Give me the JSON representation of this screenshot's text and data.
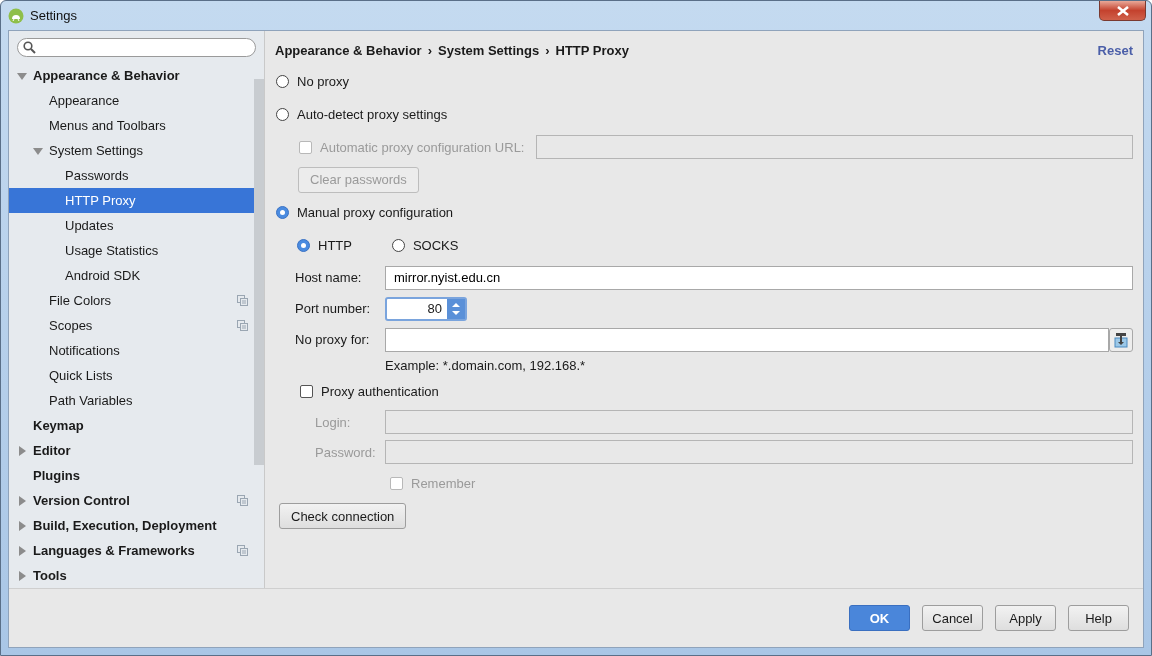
{
  "window": {
    "title": "Settings"
  },
  "sidebar": {
    "items": [
      {
        "label": "Appearance & Behavior",
        "expanded": true,
        "selected": false,
        "project_scoped": false,
        "children": [
          {
            "label": "Appearance",
            "selected": false,
            "project_scoped": false
          },
          {
            "label": "Menus and Toolbars",
            "selected": false,
            "project_scoped": false
          },
          {
            "label": "System Settings",
            "expanded": true,
            "selected": false,
            "project_scoped": false,
            "children": [
              {
                "label": "Passwords",
                "selected": false,
                "project_scoped": false
              },
              {
                "label": "HTTP Proxy",
                "selected": true,
                "project_scoped": false
              },
              {
                "label": "Updates",
                "selected": false,
                "project_scoped": false
              },
              {
                "label": "Usage Statistics",
                "selected": false,
                "project_scoped": false
              },
              {
                "label": "Android SDK",
                "selected": false,
                "project_scoped": false
              }
            ]
          },
          {
            "label": "File Colors",
            "selected": false,
            "project_scoped": true
          },
          {
            "label": "Scopes",
            "selected": false,
            "project_scoped": true
          },
          {
            "label": "Notifications",
            "selected": false,
            "project_scoped": false
          },
          {
            "label": "Quick Lists",
            "selected": false,
            "project_scoped": false
          },
          {
            "label": "Path Variables",
            "selected": false,
            "project_scoped": false
          }
        ]
      },
      {
        "label": "Keymap",
        "selected": false,
        "project_scoped": false
      },
      {
        "label": "Editor",
        "expanded": false,
        "selected": false,
        "project_scoped": false
      },
      {
        "label": "Plugins",
        "selected": false,
        "project_scoped": false
      },
      {
        "label": "Version Control",
        "expanded": false,
        "selected": false,
        "project_scoped": true
      },
      {
        "label": "Build, Execution, Deployment",
        "expanded": false,
        "selected": false,
        "project_scoped": false
      },
      {
        "label": "Languages & Frameworks",
        "expanded": false,
        "selected": false,
        "project_scoped": true
      },
      {
        "label": "Tools",
        "expanded": false,
        "selected": false,
        "project_scoped": false
      }
    ]
  },
  "breadcrumb": [
    "Appearance & Behavior",
    "System Settings",
    "HTTP Proxy"
  ],
  "breadcrumb_separator": "›",
  "reset_link": "Reset",
  "proxy_modes": [
    {
      "label": "No proxy",
      "selected": false
    },
    {
      "label": "Auto-detect proxy settings",
      "selected": false
    },
    {
      "label": "Manual proxy configuration",
      "selected": true
    }
  ],
  "auto_detect": {
    "url_checkbox": {
      "label": "Automatic proxy configuration URL:",
      "checked": false,
      "disabled": true
    },
    "clear_passwords_button": {
      "label": "Clear passwords",
      "disabled": true
    }
  },
  "protocols": [
    {
      "label": "HTTP",
      "selected": true
    },
    {
      "label": "SOCKS",
      "selected": false
    }
  ],
  "fields": [
    {
      "label": "Host name:",
      "value": "mirror.nyist.edu.cn",
      "kind": "text"
    },
    {
      "label": "Port number:",
      "value": "80",
      "kind": "spinner"
    },
    {
      "label": "No proxy for:",
      "kind": "with_button"
    }
  ],
  "hint": "Example: *.domain.com, 192.168.*",
  "authentication": {
    "label": "Proxy authentication",
    "checked": false,
    "fields": [
      {
        "label": "Login:",
        "disabled": true
      },
      {
        "label": "Password:",
        "disabled": true
      }
    ],
    "remember": {
      "label": "Remember",
      "checked": false,
      "disabled": true
    }
  },
  "check_button": "Check connection",
  "buttons": [
    {
      "label": "OK",
      "default": true
    },
    {
      "label": "Cancel",
      "default": false
    },
    {
      "label": "Apply",
      "default": false
    },
    {
      "label": "Help",
      "default": false
    }
  ]
}
